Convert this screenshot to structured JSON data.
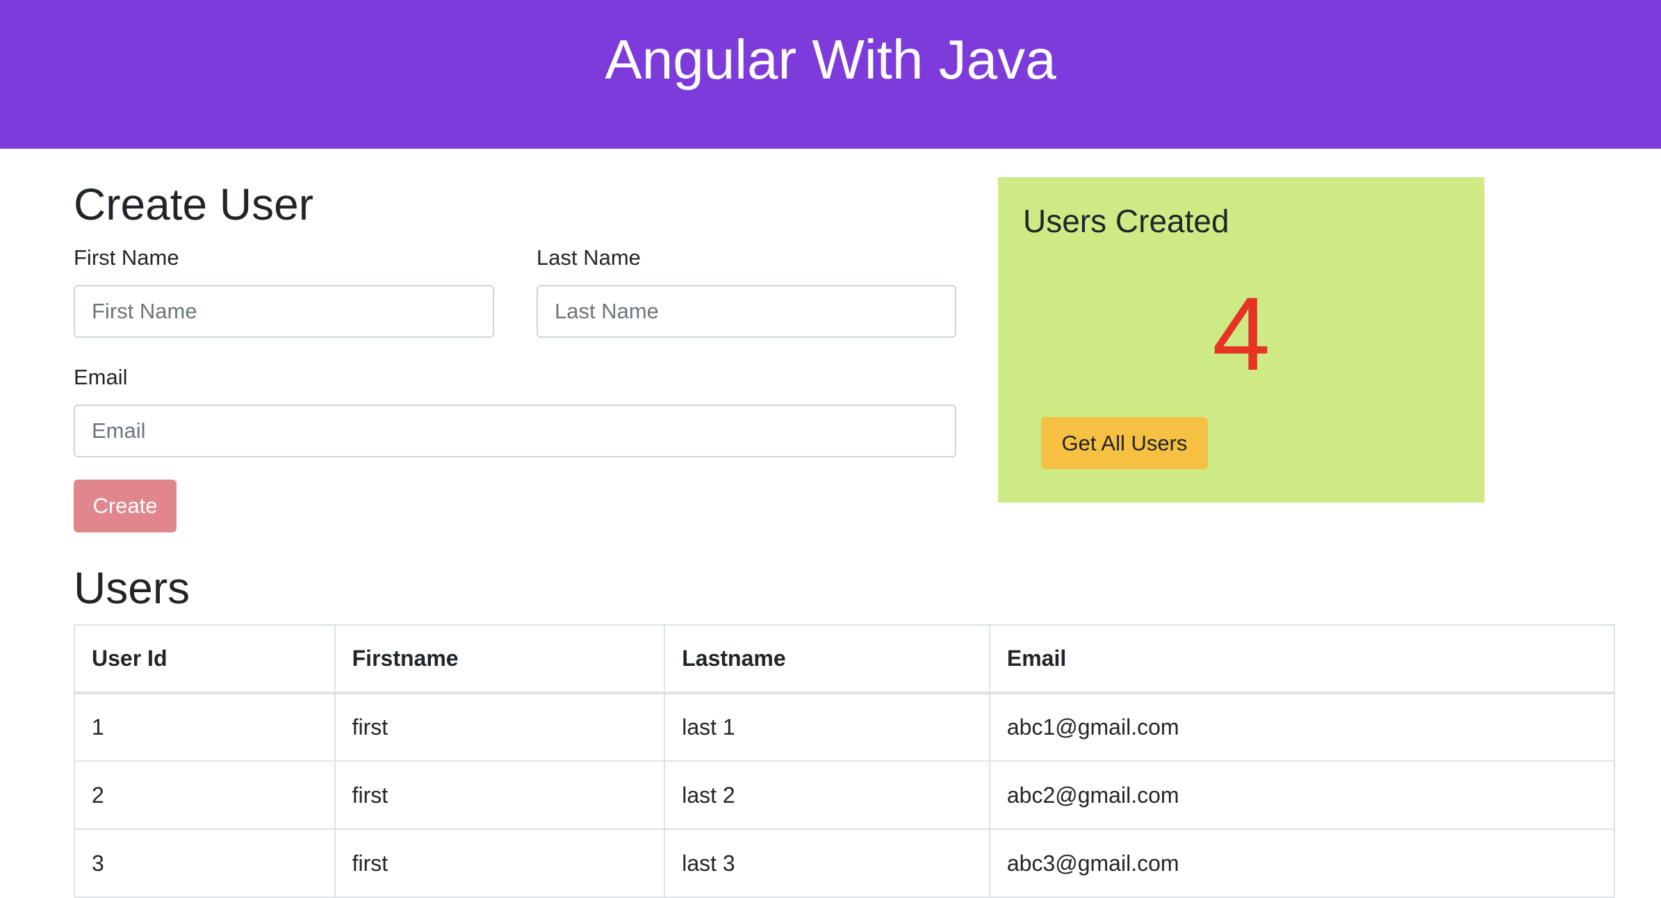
{
  "header": {
    "title": "Angular With Java"
  },
  "create_user": {
    "title": "Create User",
    "first_name": {
      "label": "First Name",
      "placeholder": "First Name",
      "value": ""
    },
    "last_name": {
      "label": "Last Name",
      "placeholder": "Last Name",
      "value": ""
    },
    "email": {
      "label": "Email",
      "placeholder": "Email",
      "value": ""
    },
    "create_button": "Create"
  },
  "summary_card": {
    "title": "Users Created",
    "count": "4",
    "get_all_button": "Get All Users"
  },
  "users": {
    "title": "Users",
    "columns": [
      "User Id",
      "Firstname",
      "Lastname",
      "Email"
    ],
    "rows": [
      [
        "1",
        "first",
        "last 1",
        "abc1@gmail.com"
      ],
      [
        "2",
        "first",
        "last 2",
        "abc2@gmail.com"
      ],
      [
        "3",
        "first",
        "last 3",
        "abc3@gmail.com"
      ]
    ]
  },
  "colors": {
    "header_bg": "#7e3bdb",
    "card_bg": "#cdea84",
    "count_color": "#e53324",
    "create_button_bg": "#e0868c",
    "get_all_button_bg": "#f6c043"
  }
}
